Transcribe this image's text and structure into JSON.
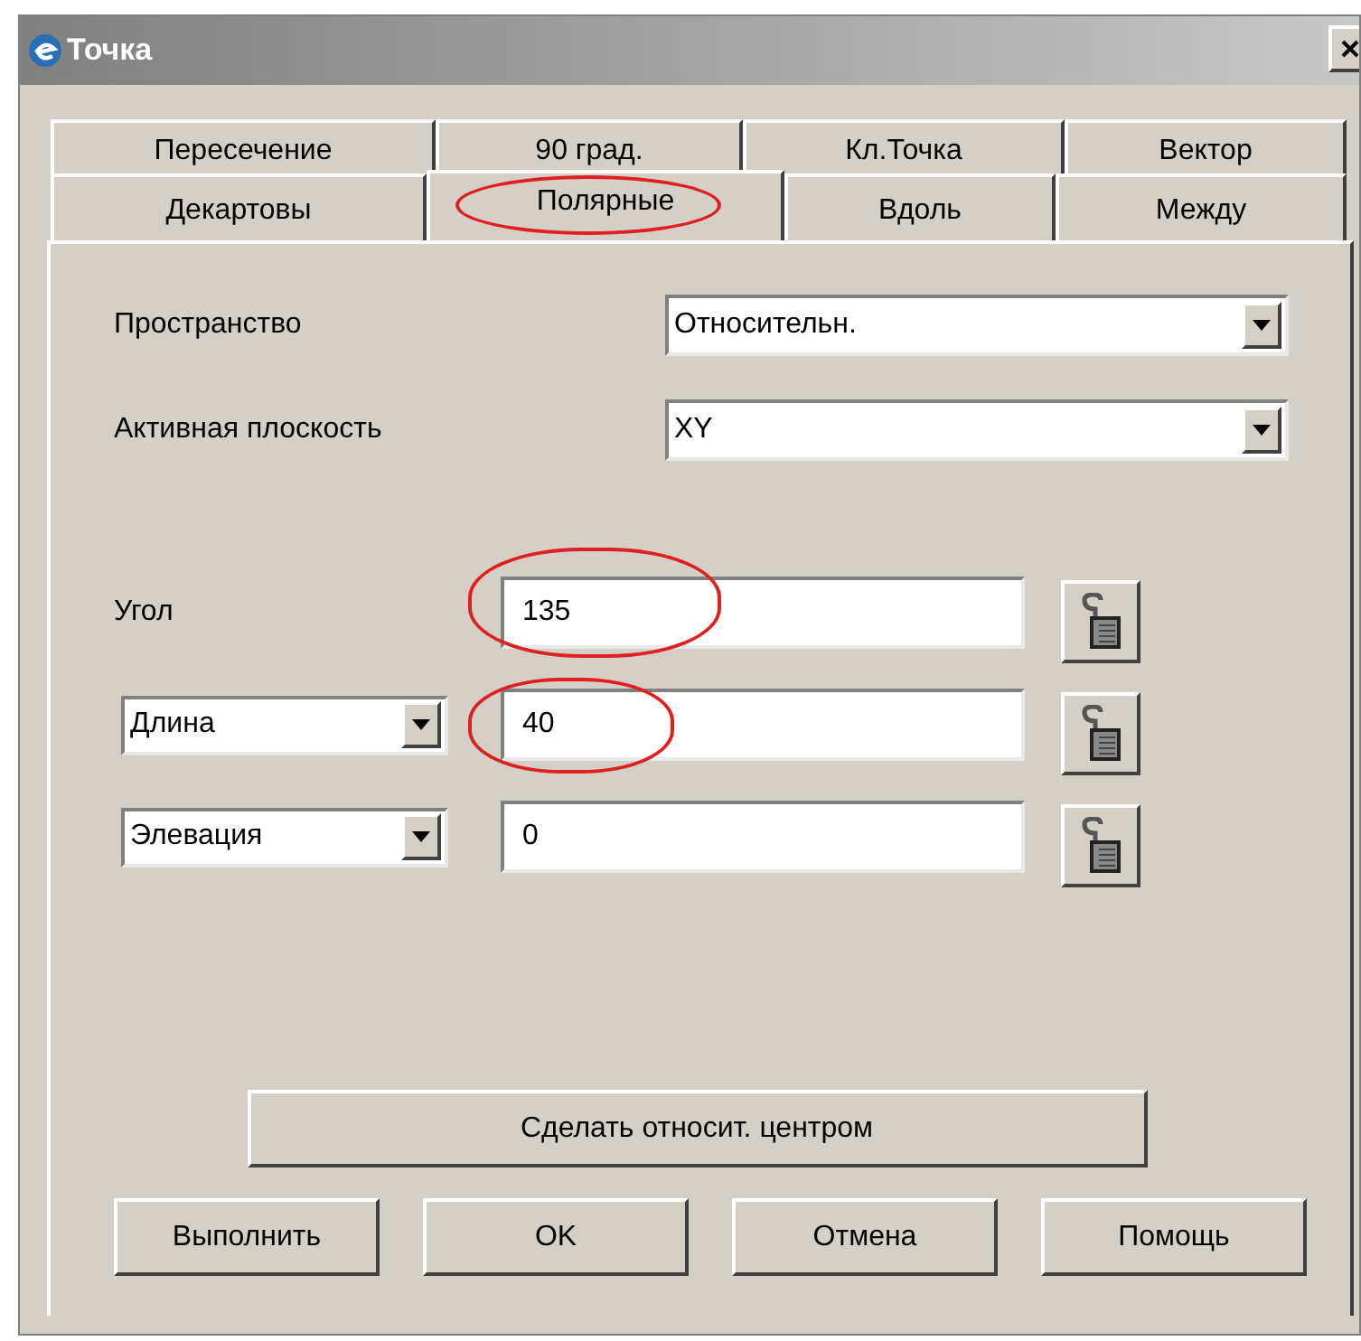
{
  "window": {
    "title": "Точка"
  },
  "tab_rows": [
    {
      "tabs": [
        {
          "label": "Пересечение",
          "selected": false,
          "annotated": false
        },
        {
          "label": "90 град.",
          "selected": false,
          "annotated": false
        },
        {
          "label": "Кл.Точка",
          "selected": false,
          "annotated": false
        },
        {
          "label": "Вектор",
          "selected": false,
          "annotated": false
        }
      ]
    },
    {
      "tabs": [
        {
          "label": "Декартовы",
          "selected": false,
          "annotated": false
        },
        {
          "label": "Полярные",
          "selected": true,
          "annotated": true
        },
        {
          "label": "Вдоль",
          "selected": false,
          "annotated": false
        },
        {
          "label": "Между",
          "selected": false,
          "annotated": false
        }
      ]
    }
  ],
  "combos": [
    {
      "label": "Пространство",
      "value": "Относительн."
    },
    {
      "label": "Активная плоскость",
      "value": "XY"
    }
  ],
  "params": [
    {
      "kind": "label",
      "label": "Угол",
      "value": "135",
      "annotated": true
    },
    {
      "kind": "dropdown",
      "label": "Длина",
      "value": "40",
      "annotated": true
    },
    {
      "kind": "dropdown",
      "label": "Элевация",
      "value": "0",
      "annotated": false
    }
  ],
  "center_button": "Сделать относит. центром",
  "buttons": [
    "Выполнить",
    "OK",
    "Отмена",
    "Помощь"
  ]
}
